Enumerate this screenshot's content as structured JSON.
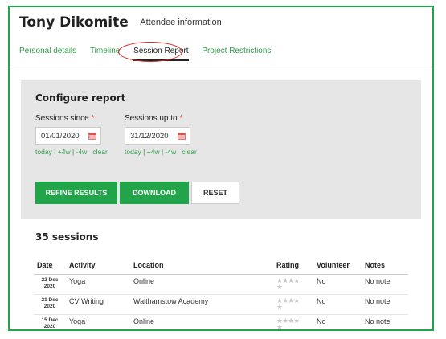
{
  "header": {
    "name": "Tony Dikomite",
    "subtitle": "Attendee information"
  },
  "tabs": [
    {
      "label": "Personal details",
      "active": false
    },
    {
      "label": "Timeline",
      "active": false
    },
    {
      "label": "Session Report",
      "active": true
    },
    {
      "label": "Project Restrictions",
      "active": false
    }
  ],
  "configure": {
    "title": "Configure report",
    "since": {
      "label": "Sessions since",
      "value": "01/01/2020"
    },
    "upto": {
      "label": "Sessions up to",
      "value": "31/12/2020"
    },
    "quick_links": {
      "today": "today",
      "plus4w": "+4w",
      "minus4w": "-4w",
      "clear": "clear"
    },
    "buttons": {
      "refine": "REFINE RESULTS",
      "download": "DOWNLOAD",
      "reset": "RESET"
    }
  },
  "results": {
    "count_label": "35 sessions",
    "columns": [
      "Date",
      "Activity",
      "Location",
      "Rating",
      "Volunteer",
      "Notes"
    ],
    "rows": [
      {
        "day": "22 Dec",
        "year": "2020",
        "activity": "Yoga",
        "location": "Online",
        "volunteer": "No",
        "notes": "No note"
      },
      {
        "day": "21 Dec",
        "year": "2020",
        "activity": "CV Writing",
        "location": "Walthamstow Academy",
        "volunteer": "No",
        "notes": "No note"
      },
      {
        "day": "15 Dec",
        "year": "2020",
        "activity": "Yoga",
        "location": "Online",
        "volunteer": "No",
        "notes": "No note"
      }
    ]
  },
  "colors": {
    "accent": "#22a54a",
    "highlight_circle": "#d92020",
    "panel_bg": "#e6e6e6"
  }
}
